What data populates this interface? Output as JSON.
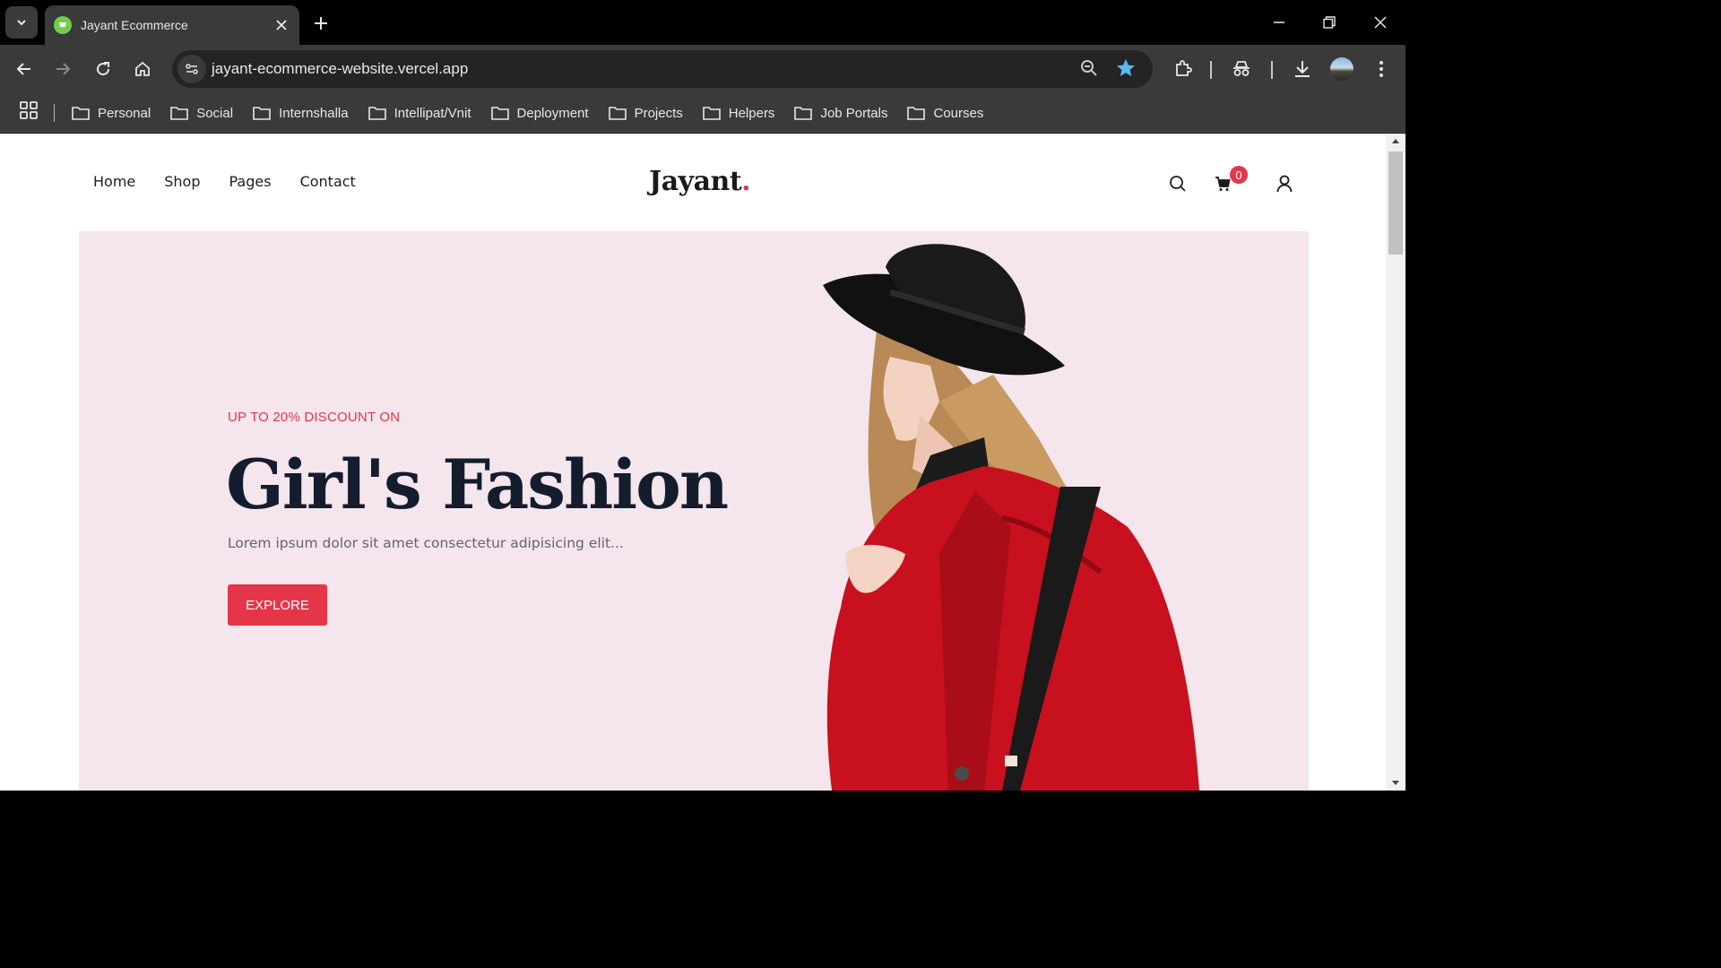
{
  "browser": {
    "tab": {
      "title": "Jayant Ecommerce"
    },
    "url": "jayant-ecommerce-website.vercel.app",
    "bookmarks": [
      "Personal",
      "Social",
      "Internshalla",
      "Intellipat/Vnit",
      "Deployment",
      "Projects",
      "Helpers",
      "Job Portals",
      "Courses"
    ]
  },
  "site": {
    "nav": {
      "home": "Home",
      "shop": "Shop",
      "pages": "Pages",
      "contact": "Contact"
    },
    "logo": {
      "text": "Jayant",
      "dot": "."
    },
    "cart_count": "0",
    "hero": {
      "subtitle": "UP TO 20% DISCOUNT ON",
      "title": "Girl's Fashion",
      "description": "Lorem ipsum dolor sit amet consectetur adipisicing elit...",
      "button": "EXPLORE"
    },
    "colors": {
      "accent": "#e53649",
      "hero_bg": "#f4e6ec",
      "title": "#141c2e"
    }
  }
}
